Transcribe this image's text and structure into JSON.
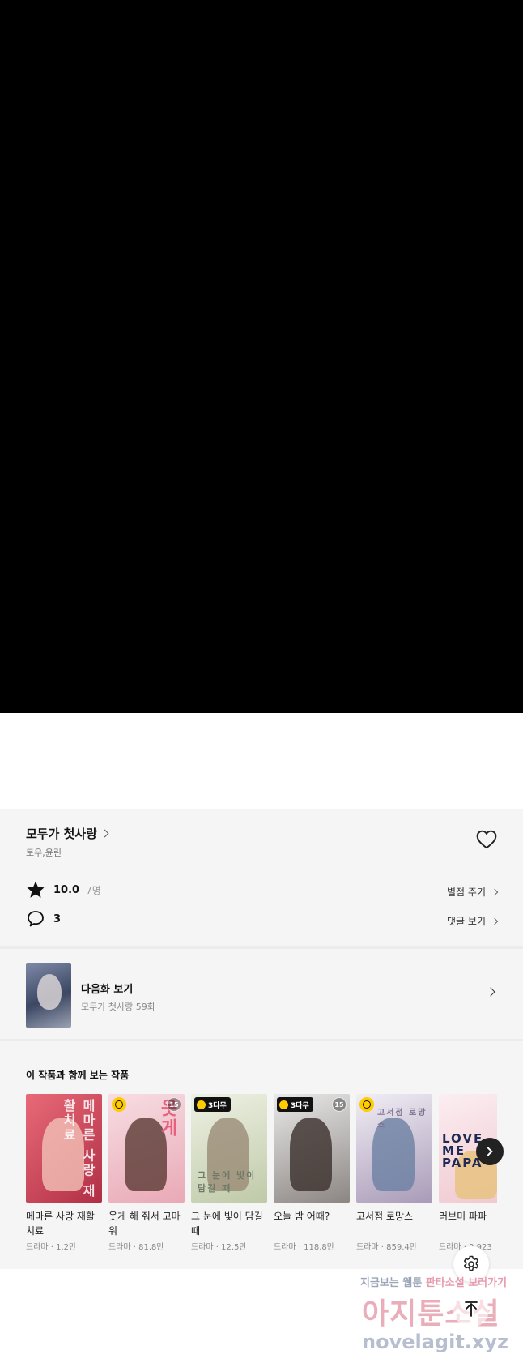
{
  "series": {
    "title": "모두가 첫사랑",
    "author": "토우,윤린"
  },
  "rating": {
    "score": "10.0",
    "count": "7명",
    "action_label": "별점 주기"
  },
  "comments": {
    "count": "3",
    "action_label": "댓글 보기"
  },
  "next_episode": {
    "label": "다음화 보기",
    "subtitle": "모두가 첫사랑 59화"
  },
  "recommendations": {
    "heading": "이 작품과 함께 보는 작품",
    "items": [
      {
        "title": "메마른 사랑 재활치료",
        "meta": "드라마 · 1.2만",
        "cover_text": "메마른 사랑 재활치료",
        "cover_color": "#d84a5c",
        "badge": ""
      },
      {
        "title": "웃게 해 줘서 고마워",
        "meta": "드라마 · 81.8만",
        "cover_text": "웃게",
        "cover_color": "#f1c7cf",
        "badge": "clock",
        "badge_15": "15"
      },
      {
        "title": "그 눈에 빛이 담길 때",
        "meta": "드라마 · 12.5만",
        "cover_text": "그 눈에 빛이 담길 때",
        "cover_color": "#c9d3b8",
        "badge": "3h",
        "badge_3h_label": "3다무"
      },
      {
        "title": "오늘 밤 어때?",
        "meta": "드라마 · 118.8만",
        "cover_text": "",
        "cover_color": "#4a4340",
        "badge": "3h",
        "badge_3h_label": "3다무",
        "badge_15": "15"
      },
      {
        "title": "고서점 로망스",
        "meta": "드라마 · 859.4만",
        "cover_text": "고서점 로망스",
        "cover_color": "#b9a8c4",
        "badge": "clock"
      },
      {
        "title": "러브미 파파",
        "meta": "드라마 · 2,923",
        "cover_text": "LOVE ME PAPA",
        "cover_color": "#f3d6dc",
        "badge": ""
      }
    ]
  },
  "watermark": {
    "line1_a": "지금보는 웹툰",
    "line1_b": "판타소설 보러가기",
    "line2": "아지툰소설",
    "line3": "novelagit.xyz"
  },
  "colors": {
    "viewer_background": "#000000",
    "panel_background": "#f5f5f5",
    "badge_yellow": "#ffcc00"
  },
  "icons": [
    "star-icon",
    "comment-icon",
    "heart-icon",
    "chevron-right-icon",
    "gear-icon",
    "arrow-up-icon"
  ]
}
